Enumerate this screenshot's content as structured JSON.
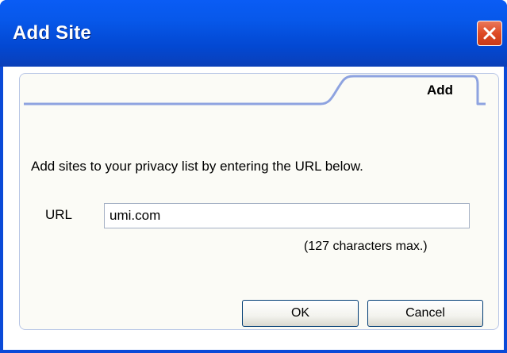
{
  "window": {
    "title": "Add Site",
    "close_icon": "close-icon",
    "colors": {
      "titlebar": "#0a5cf5",
      "close": "#de4a25",
      "panel_border": "#b8c6e6",
      "tab_line": "#8ea3e0"
    }
  },
  "tab": {
    "label": "Add"
  },
  "form": {
    "description": "Add sites to your privacy list by entering the URL below.",
    "url_label": "URL",
    "url_value": "umi.com",
    "max_note": "(127 characters max.)"
  },
  "buttons": {
    "ok": "OK",
    "cancel": "Cancel"
  }
}
